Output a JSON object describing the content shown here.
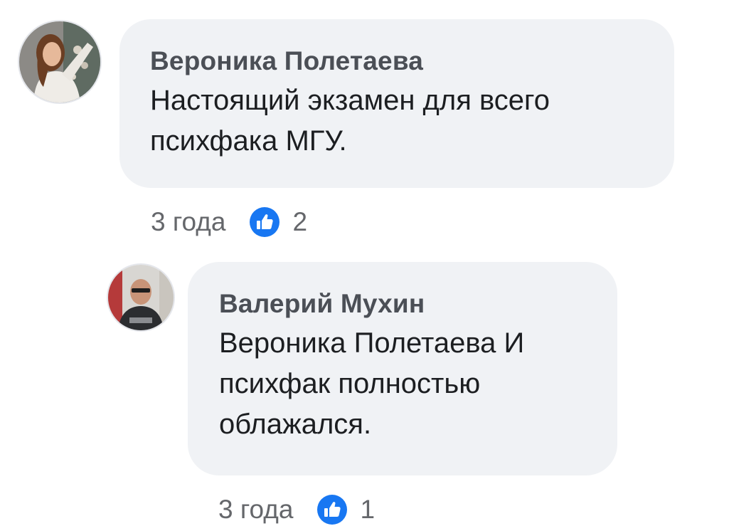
{
  "comments": [
    {
      "author": "Вероника Полетаева",
      "text": "Настоящий экзамен для всего\nпсихфака МГУ.",
      "time": "3 года",
      "likes": "2",
      "avatar_icon": "avatar-photo-woman",
      "like_icon": "thumbs-up-icon"
    },
    {
      "author": "Валерий Мухин",
      "text": "Вероника Полетаева И\nпсихфак полностью\nоблажался.",
      "time": "3 года",
      "likes": "1",
      "avatar_icon": "avatar-photo-man",
      "like_icon": "thumbs-up-icon"
    }
  ],
  "colors": {
    "bubble": "#f0f2f5",
    "author": "#4b4f56",
    "text": "#1c1e21",
    "meta": "#65676b",
    "like_blue": "#1877f2"
  }
}
